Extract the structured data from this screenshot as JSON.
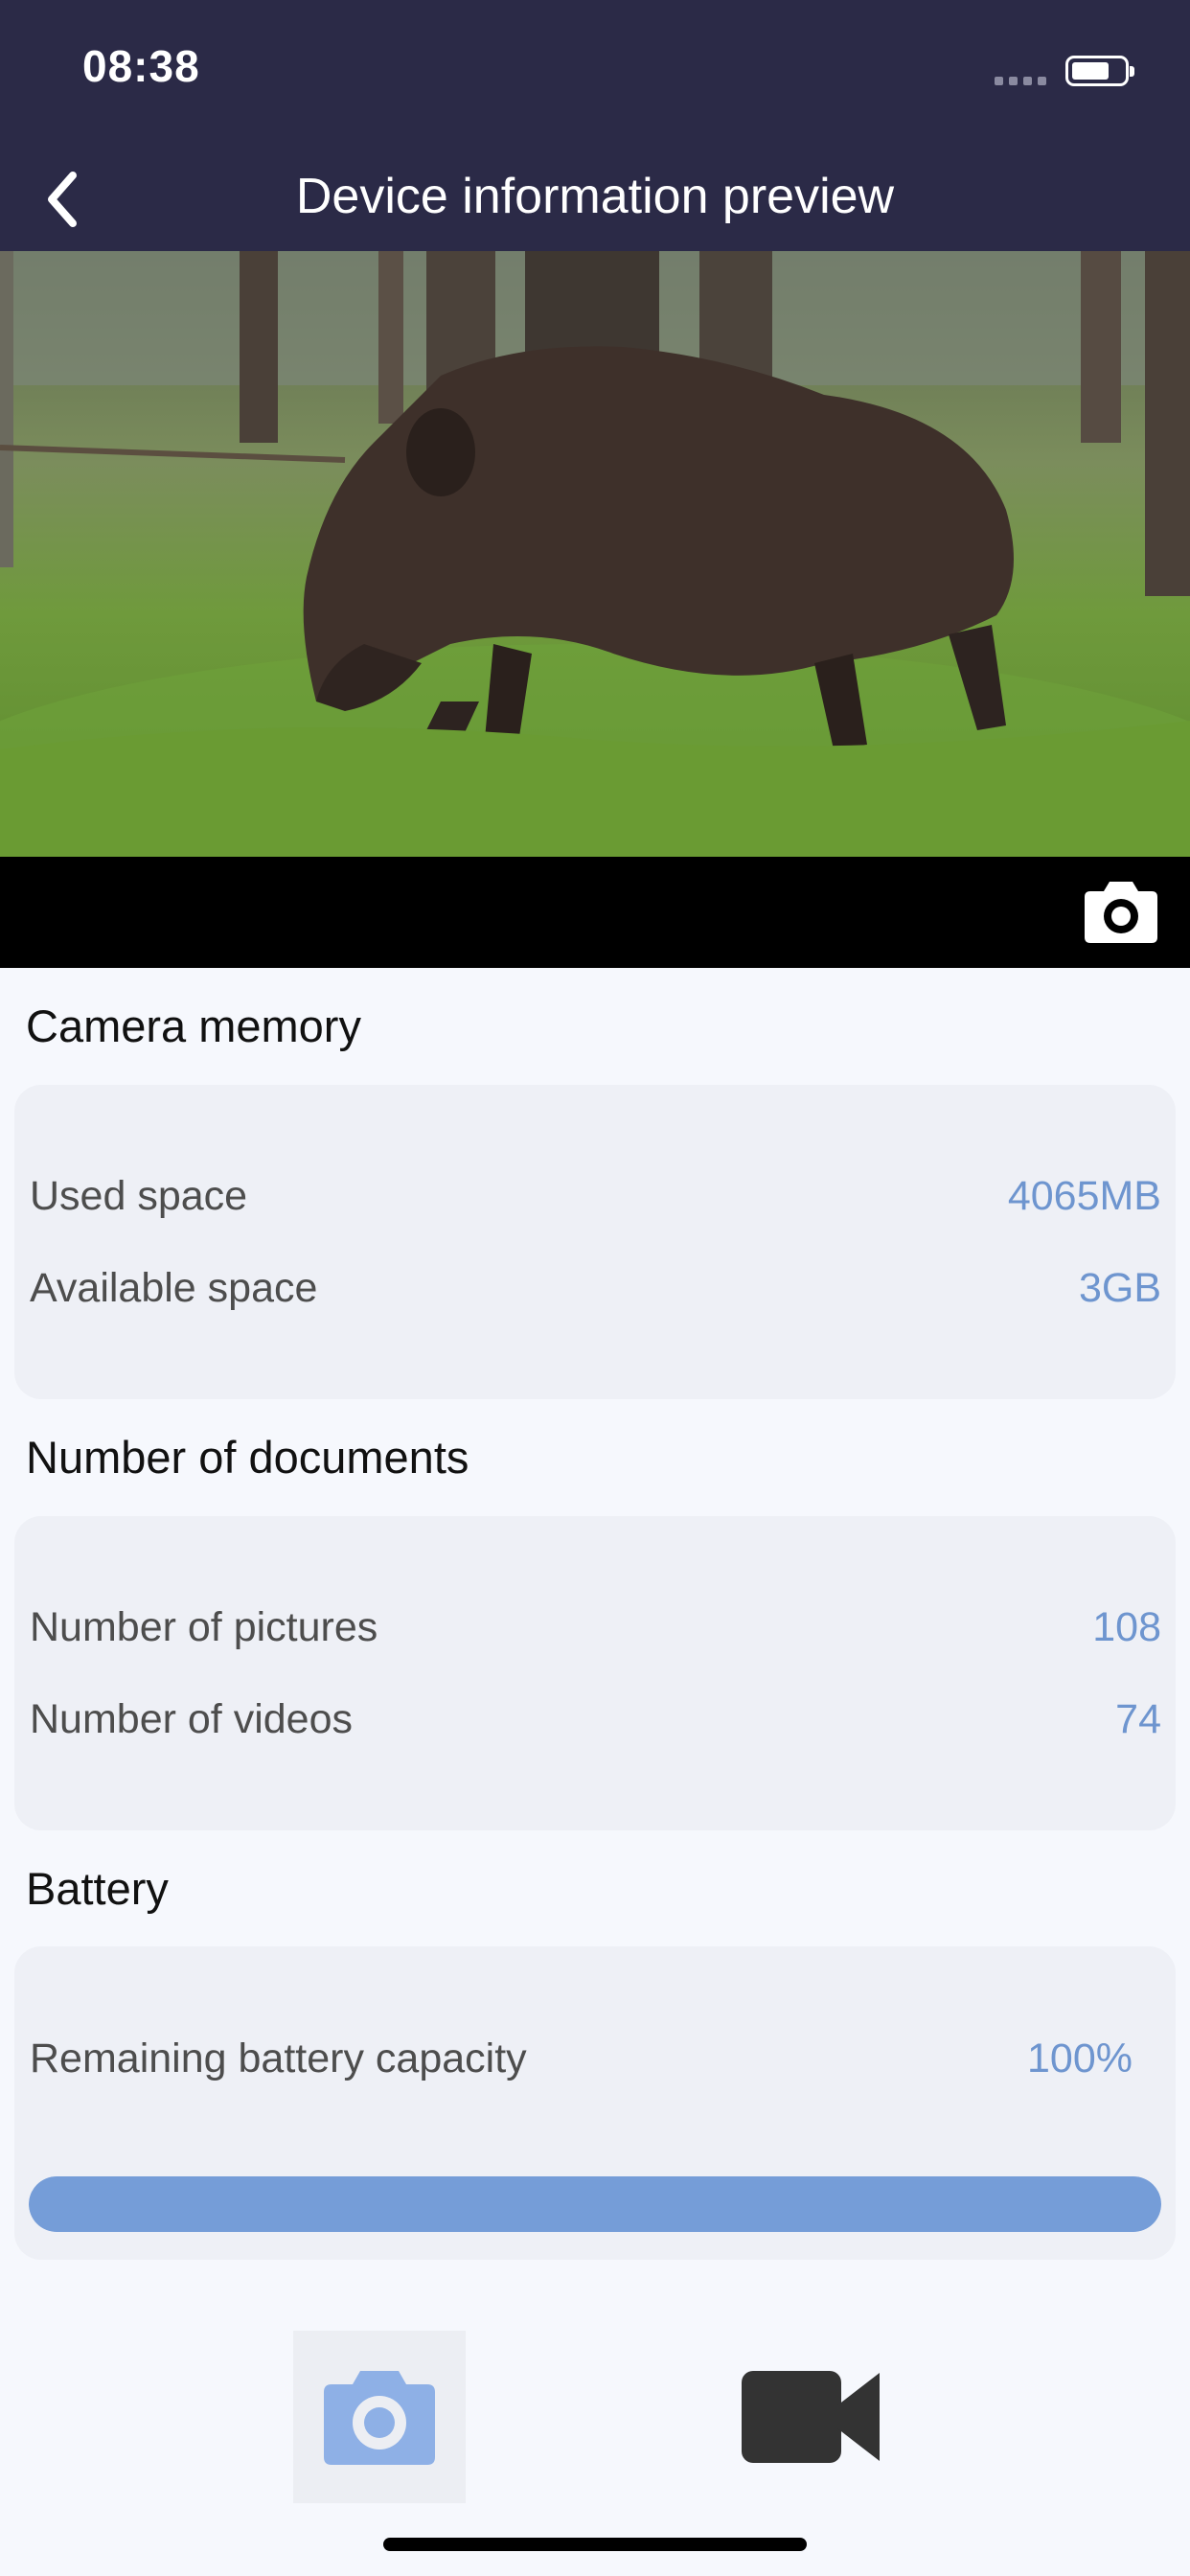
{
  "status_bar": {
    "time": "08:38"
  },
  "nav": {
    "title": "Device information preview"
  },
  "preview": {
    "image": "wild boar walking through forest grass"
  },
  "camera_memory": {
    "title": "Camera memory",
    "used_label": "Used space",
    "used_value": "4065MB",
    "available_label": "Available space",
    "available_value": "3GB"
  },
  "documents": {
    "title": "Number of documents",
    "pictures_label": "Number of pictures",
    "pictures_value": "108",
    "videos_label": "Number of videos",
    "videos_value": "74"
  },
  "battery": {
    "title": "Battery",
    "remaining_label": "Remaining battery capacity",
    "remaining_value": "100%",
    "level_percent": 100
  },
  "icons": {
    "back": "chevron-left-icon",
    "snapshot": "camera-icon",
    "photo_mode": "camera-icon",
    "video_mode": "video-camera-icon"
  },
  "colors": {
    "header_bg": "#2b2a47",
    "accent": "#6e95cf",
    "progress": "#759dd8",
    "page_bg": "#f6f8fd",
    "card_bg": "#eef0f6"
  }
}
